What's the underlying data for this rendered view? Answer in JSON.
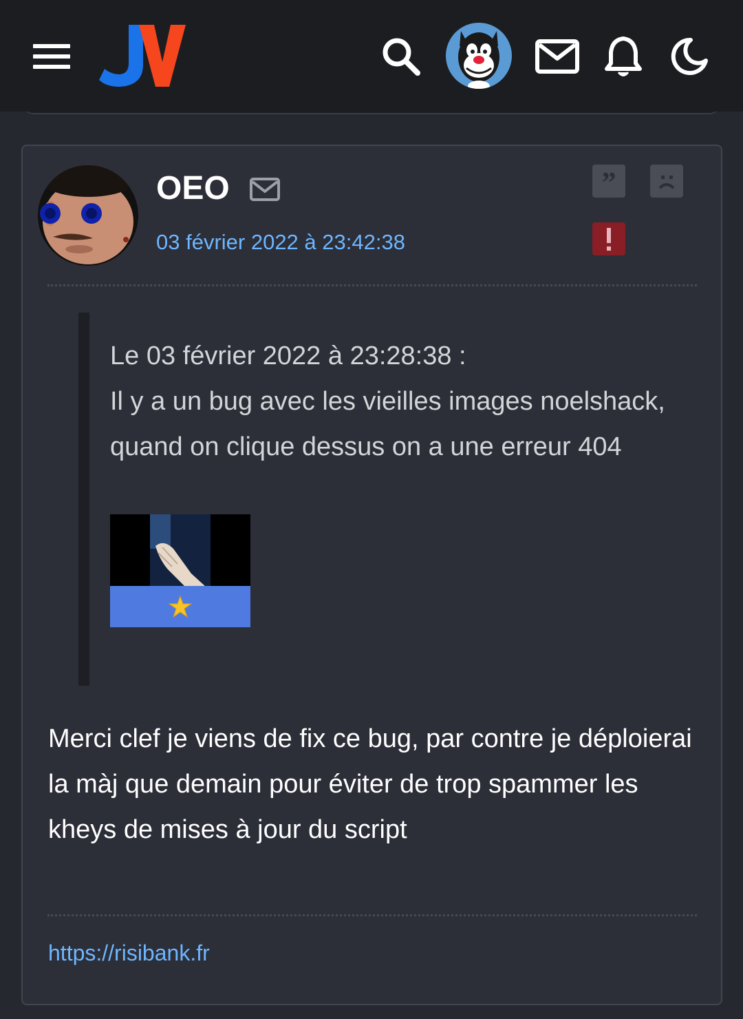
{
  "header": {
    "logo_text": "JV",
    "colors": {
      "bar_bg": "#1c1d21",
      "logo_j": "#1a73e8",
      "logo_v": "#f5461e"
    },
    "icons": [
      "menu-icon",
      "search-icon",
      "user-avatar",
      "mail-icon",
      "bell-icon",
      "moon-icon"
    ]
  },
  "post": {
    "author": "OEO",
    "date": "03 février 2022 à 23:42:38",
    "actions": [
      "quote-icon",
      "sad-face-icon",
      "alert-icon"
    ],
    "quote": {
      "header": "Le 03 février 2022 à 23:28:38 :",
      "text": "Il y a un bug avec les vieilles images noelshack, quand on clique dessus on a une erreur 404"
    },
    "message": "Merci clef je viens de fix ce bug, par contre je déploierai la màj que demain pour éviter de trop spammer les kheys de mises à jour du script",
    "signature_link": "https://risibank.fr"
  },
  "colors": {
    "page_bg": "#262830",
    "card_bg": "#2c2e38",
    "link": "#6eb6ff",
    "warn": "#8a1e26"
  }
}
